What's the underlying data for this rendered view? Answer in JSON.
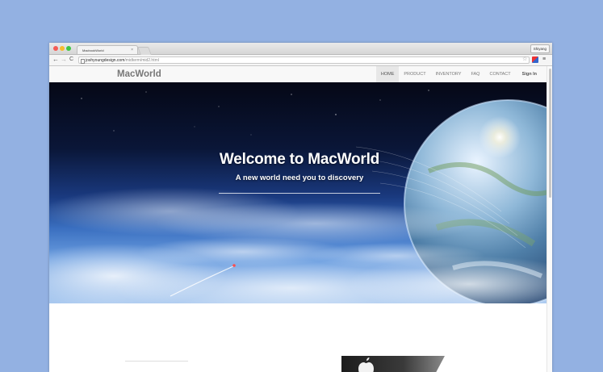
{
  "browser": {
    "tab_title": "MacbookWorld",
    "tab_close": "×",
    "profile": "Shiyang",
    "url_domain": "joshyoungdesign.com",
    "url_path": "/midterm/mid2.html",
    "back": "←",
    "forward": "→",
    "reload": "C",
    "star": "☆",
    "menu": "≡"
  },
  "site": {
    "brand": "MacWorld",
    "nav": [
      {
        "label": "HOME"
      },
      {
        "label": "PRODUCT"
      },
      {
        "label": "INVENTORY"
      },
      {
        "label": "FAQ"
      },
      {
        "label": "CONTACT"
      },
      {
        "label": "Sign In"
      }
    ],
    "active_nav": "HOME"
  },
  "hero": {
    "title": "Welcome to MacWorld",
    "subtitle": "A new world need you to discovery"
  },
  "colors": {
    "background": "#93b1e2",
    "nav_active": "#e7e7e7",
    "sky_dark": "#050816",
    "sky_light": "#a8c8ef"
  }
}
